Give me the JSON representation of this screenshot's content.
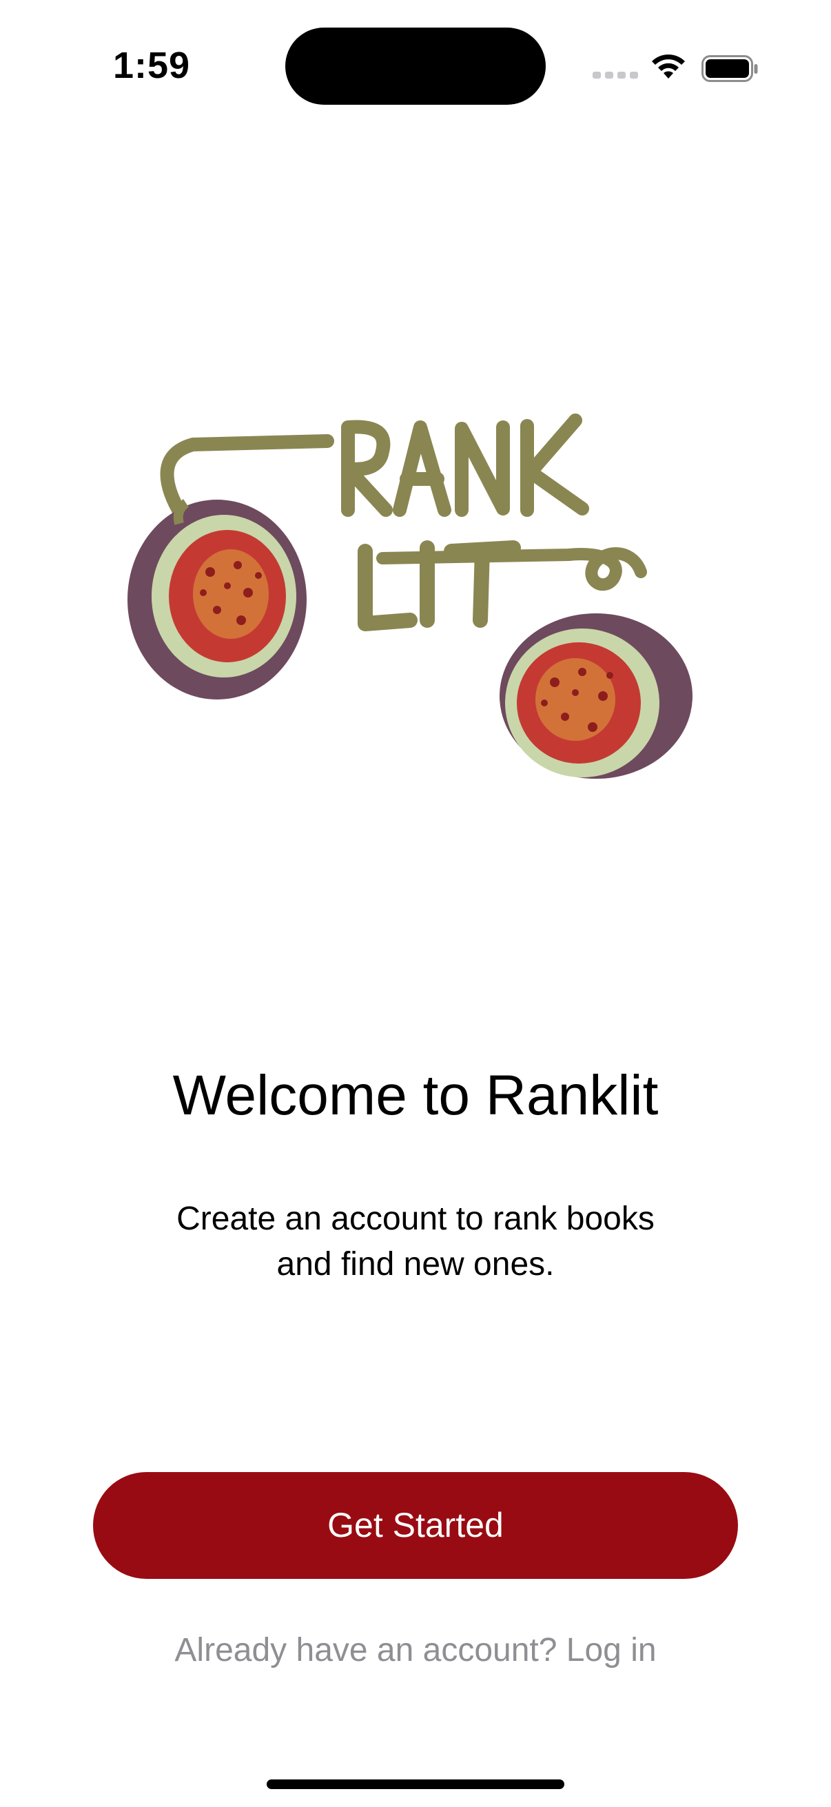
{
  "status_bar": {
    "time": "1:59",
    "icons": [
      "cellular-dots-icon",
      "wifi-icon",
      "battery-icon"
    ]
  },
  "logo": {
    "lettering": "RANK LIT",
    "colors": {
      "stem": "#8a8652",
      "fig_skin": "#6e4a5e",
      "fig_rind": "#c9d6a9",
      "fig_flesh": "#c43a33",
      "fig_seeds": "#e0a13c"
    }
  },
  "welcome": {
    "title": "Welcome to Ranklit",
    "subtitle_line1": "Create an account to rank books",
    "subtitle_line2": "and find new ones."
  },
  "actions": {
    "get_started_label": "Get Started",
    "login_label": "Already have an account? Log in"
  },
  "colors": {
    "accent": "#990b12",
    "secondary_text": "#8e8e93",
    "background": "#ffffff"
  }
}
